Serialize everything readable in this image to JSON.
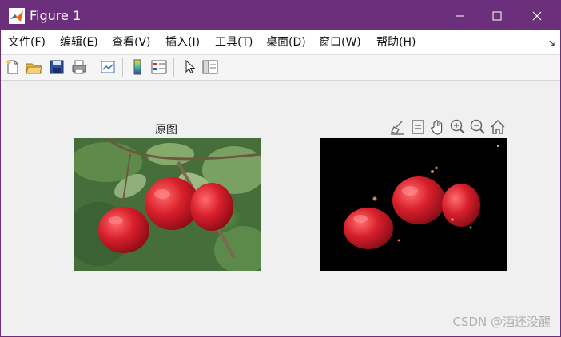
{
  "window": {
    "title": "Figure 1",
    "controls": [
      "minimize",
      "maximize",
      "close"
    ]
  },
  "menu": {
    "items": [
      "文件(F)",
      "编辑(E)",
      "查看(V)",
      "插入(I)",
      "工具(T)",
      "桌面(D)",
      "窗口(W)",
      "帮助(H)"
    ],
    "overflow": "↘"
  },
  "toolbar": {
    "buttons": [
      "new-figure-icon",
      "open-file-icon",
      "save-icon",
      "print-icon",
      "link-plot-icon",
      "colorbar-icon",
      "legend-icon",
      "pointer-icon",
      "property-editor-icon"
    ]
  },
  "figure": {
    "left_title": "原图",
    "axes_toolbar": [
      "brush-icon",
      "data-tips-icon",
      "pan-hand-icon",
      "zoom-in-icon",
      "zoom-out-icon",
      "home-icon"
    ]
  },
  "watermark": "CSDN @酒还没醒",
  "colors": {
    "titlebar": "#6b2f7b",
    "window_bg": "#f0f0f0",
    "apple_red": "#d81f2c"
  }
}
